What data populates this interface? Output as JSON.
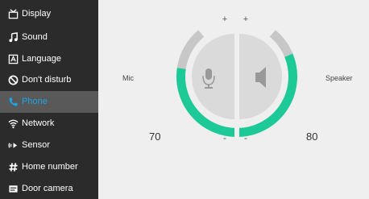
{
  "sidebar": {
    "items": [
      {
        "label": "Display",
        "icon": "tv-icon"
      },
      {
        "label": "Sound",
        "icon": "music-note-icon"
      },
      {
        "label": "Language",
        "icon": "language-icon"
      },
      {
        "label": "Don't disturb",
        "icon": "do-not-disturb-icon"
      },
      {
        "label": "Phone",
        "icon": "phone-icon",
        "active": true
      },
      {
        "label": "Network",
        "icon": "wifi-icon"
      },
      {
        "label": "Sensor",
        "icon": "sensor-icon"
      },
      {
        "label": "Home number",
        "icon": "hash-icon"
      },
      {
        "label": "Door camera",
        "icon": "door-camera-icon"
      }
    ]
  },
  "mic": {
    "label": "Mic",
    "value": "70",
    "level": 0.7,
    "plus": "+",
    "minus": "-",
    "icon": "microphone-icon"
  },
  "speaker": {
    "label": "Speaker",
    "value": "80",
    "level": 0.8,
    "plus": "+",
    "minus": "-",
    "icon": "speaker-icon"
  },
  "colors": {
    "active_arc": "#1dc996",
    "inactive_arc": "#c7c7c7",
    "highlight": "#1aa7e6",
    "sidebar_bg": "#2b2b2b"
  }
}
